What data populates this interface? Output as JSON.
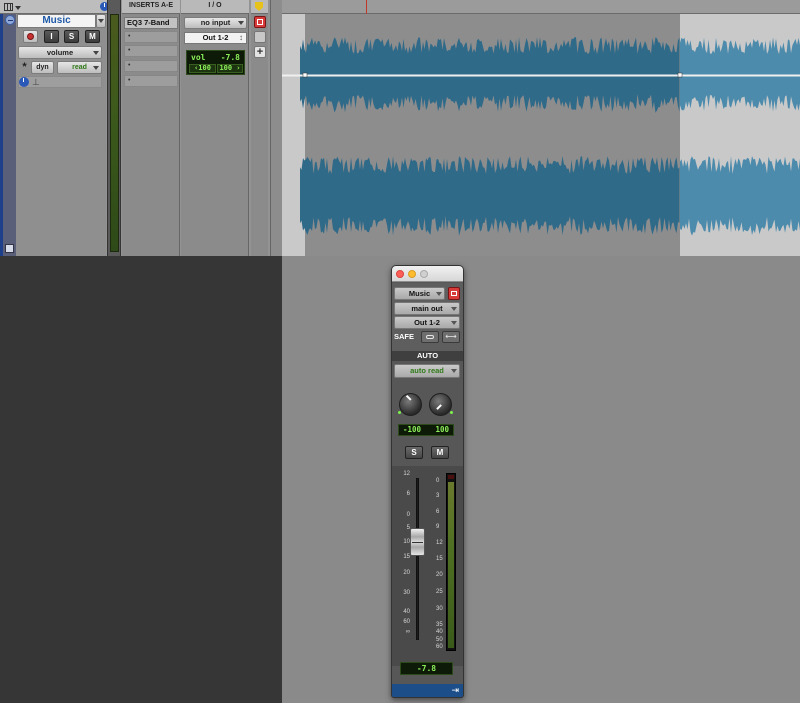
{
  "edit": {
    "track_name": "Music",
    "rec_label": "",
    "input_monitor_label": "I",
    "solo_label": "S",
    "mute_label": "M",
    "view_label": "volume",
    "dyn_label": "dyn",
    "auto_mode": "read",
    "inserts_header": "INSERTS A-E",
    "insert_1": "EQ3 7-Band",
    "insert_placeholder": "•",
    "io_header": "I / O",
    "input": "no input",
    "output": "Out 1-2",
    "vol_label": "vol",
    "vol_value": "-7.8",
    "pan_left": "‹100",
    "pan_right": "100 ›"
  },
  "window": {
    "track_name": "Music",
    "send": "main out",
    "output": "Out 1-2",
    "safe_label": "SAFE",
    "auto_header": "AUTO",
    "auto_mode": "auto read",
    "pan_left": "-100",
    "pan_right": "100",
    "solo_label": "S",
    "mute_label": "M",
    "fader_scale": [
      "12",
      "6",
      "0",
      "5",
      "10",
      "15",
      "20",
      "30",
      "40",
      "60",
      "∞"
    ],
    "meter_scale": [
      "0",
      "3",
      "6",
      "9",
      "12",
      "15",
      "20",
      "25",
      "30",
      "35",
      "40",
      "50",
      "60"
    ],
    "volume": "-7.8",
    "fader_level_db": -7.8
  },
  "colors": {
    "waveform": "#4d8bac",
    "waveform_selected": "#306a89",
    "track_name": "#1f5aa8",
    "lcd_text": "#8df05a",
    "auto_read": "#2f7a17"
  },
  "icons": {
    "record": "record-icon",
    "close": "close-icon",
    "link": "link-icon",
    "stereo": "stereo-icon",
    "expand": "expand-icon"
  }
}
